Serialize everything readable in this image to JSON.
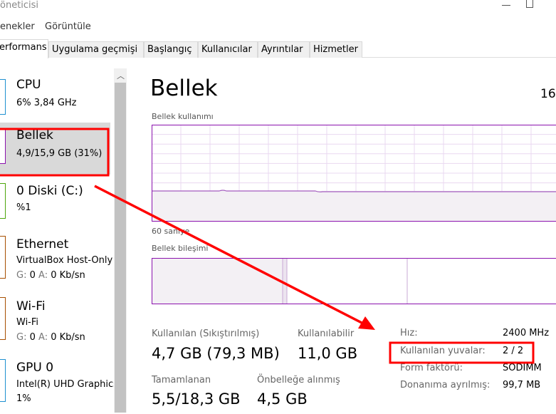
{
  "window": {
    "title": "öneticisi"
  },
  "menu": [
    "enekler",
    "Görüntüle"
  ],
  "tabs": [
    "erformans",
    "Uygulama geçmişi",
    "Başlangıç",
    "Kullanıcılar",
    "Ayrıntılar",
    "Hizmetler"
  ],
  "sidebar": [
    {
      "name": "CPU",
      "sub": "6%  3,84 GHz",
      "color": "#1e90d0"
    },
    {
      "name": "Bellek",
      "sub": "4,9/15,9 GB (31%)",
      "color": "#8b12ae",
      "selected": true
    },
    {
      "name": "0 Diski (C:)",
      "sub": "%1",
      "color": "#4da60c"
    },
    {
      "name": "Ethernet",
      "sub": "VirtualBox Host-Only",
      "g": "G:",
      "gv": "0",
      "a": "A:",
      "av": "0 Kb/sn",
      "color": "#a74f01"
    },
    {
      "name": "Wi-Fi",
      "sub": "Wi-Fi",
      "g": "G:",
      "gv": "0",
      "a": "A:",
      "av": "0 Kb/sn",
      "color": "#a74f01"
    },
    {
      "name": "GPU 0",
      "sub": "Intel(R) UHD Graphics",
      "sub2": "1%",
      "color": "#1e90d0"
    }
  ],
  "main": {
    "title": "Bellek",
    "total": "16",
    "usage_label": "Bellek kullanımı",
    "time_label": "60 saniye",
    "composition_label": "Bellek bileşimi",
    "usage_percent": 31,
    "stats": [
      {
        "label": "Kullanılan (Sıkıştırılmış)",
        "value": "4,7 GB (79,3 MB)"
      },
      {
        "label": "Kullanılabilir",
        "value": "11,0 GB"
      },
      {
        "label": "Tamamlanan",
        "value": "5,5/18,3 GB"
      },
      {
        "label": "Önbelleğe alınmış",
        "value": "4,5 GB"
      }
    ],
    "details": [
      {
        "k": "Hız:",
        "v": "2400 MHz"
      },
      {
        "k": "Kullanılan yuvalar:",
        "v": "2 / 2"
      },
      {
        "k": "Form faktörü:",
        "v": "SODIMM"
      },
      {
        "k": "Donanıma ayrılmış:",
        "v": "99,7 MB"
      }
    ],
    "accent": "#8b12ae"
  },
  "annotation_color": "#ff0000"
}
